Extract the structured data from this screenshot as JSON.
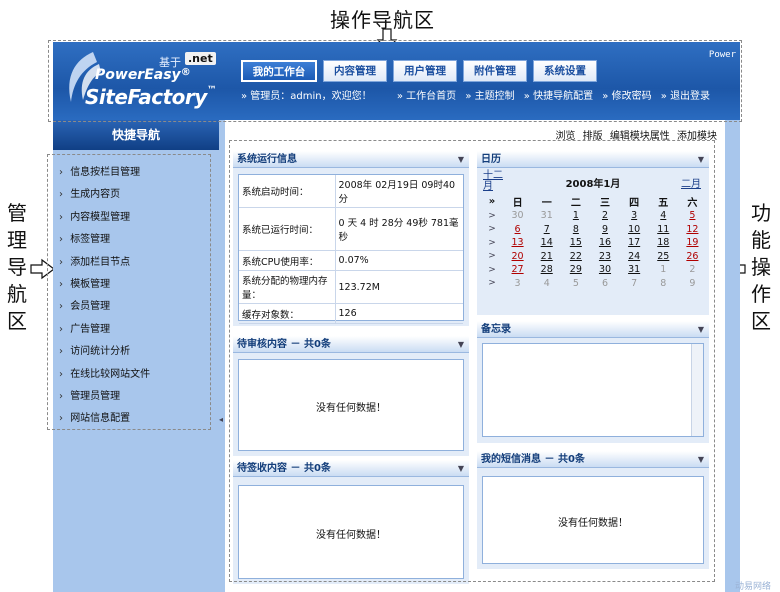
{
  "annotations": {
    "top": "操作导航区",
    "left": [
      "管",
      "理",
      "导",
      "航",
      "区"
    ],
    "right": [
      "功",
      "能",
      "操",
      "作",
      "区"
    ]
  },
  "header": {
    "based_on": "基于",
    "net_badge": ".net",
    "brand_top": "PowerEasy",
    "brand_bottom": "SiteFactory",
    "corner_text": "Power",
    "nav": [
      {
        "label": "我的工作台",
        "active": true
      },
      {
        "label": "内容管理",
        "active": false
      },
      {
        "label": "用户管理",
        "active": false
      },
      {
        "label": "附件管理",
        "active": false
      },
      {
        "label": "系统设置",
        "active": false
      }
    ],
    "greeting": "» 管理员：admin，欢迎您！",
    "links": [
      "» 工作台首页",
      "» 主题控制",
      "» 快捷导航配置",
      "» 修改密码",
      "» 退出登录"
    ]
  },
  "sidebar": {
    "title": "快捷导航",
    "items": [
      "信息按栏目管理",
      "生成内容页",
      "内容模型管理",
      "标签管理",
      "添加栏目节点",
      "模板管理",
      "会员管理",
      "广告管理",
      "访问统计分析",
      "在线比较网站文件",
      "管理员管理",
      "网站信息配置"
    ]
  },
  "toolbar": [
    "浏览",
    "排版",
    "编辑模块属性",
    "添加模块"
  ],
  "system_info": {
    "title": "系统运行信息",
    "rows": [
      {
        "key": "系统启动时间：",
        "value": "2008年 02月19日 09时40分"
      },
      {
        "key": "系统已运行时间：",
        "value": "0 天 4 时 28分 49秒 781毫秒"
      },
      {
        "key": "系统CPU使用率：",
        "value": "0.07%"
      },
      {
        "key": "系统分配的物理内存量：",
        "value": "123.72M"
      },
      {
        "key": "缓存对象数：",
        "value": "126"
      }
    ]
  },
  "pending_review": {
    "title": "待审核内容 － 共0条",
    "empty": "没有任何数据！"
  },
  "pending_sign": {
    "title": "待签收内容 － 共0条",
    "empty": "没有任何数据！"
  },
  "calendar": {
    "title": "日历",
    "prev": "十二月",
    "month": "2008年1月",
    "next": "二月",
    "weekdays": [
      "»",
      "日",
      "一",
      "二",
      "三",
      "四",
      "五",
      "六"
    ],
    "week_arrow": ">",
    "weeks": [
      [
        {
          "d": "30",
          "t": "other"
        },
        {
          "d": "31",
          "t": "other"
        },
        {
          "d": "1",
          "t": ""
        },
        {
          "d": "2",
          "t": ""
        },
        {
          "d": "3",
          "t": ""
        },
        {
          "d": "4",
          "t": ""
        },
        {
          "d": "5",
          "t": "wkend"
        }
      ],
      [
        {
          "d": "6",
          "t": "wkend"
        },
        {
          "d": "7",
          "t": ""
        },
        {
          "d": "8",
          "t": ""
        },
        {
          "d": "9",
          "t": ""
        },
        {
          "d": "10",
          "t": ""
        },
        {
          "d": "11",
          "t": ""
        },
        {
          "d": "12",
          "t": "wkend"
        }
      ],
      [
        {
          "d": "13",
          "t": "wkend"
        },
        {
          "d": "14",
          "t": ""
        },
        {
          "d": "15",
          "t": ""
        },
        {
          "d": "16",
          "t": ""
        },
        {
          "d": "17",
          "t": ""
        },
        {
          "d": "18",
          "t": ""
        },
        {
          "d": "19",
          "t": "wkend"
        }
      ],
      [
        {
          "d": "20",
          "t": "wkend"
        },
        {
          "d": "21",
          "t": ""
        },
        {
          "d": "22",
          "t": ""
        },
        {
          "d": "23",
          "t": ""
        },
        {
          "d": "24",
          "t": ""
        },
        {
          "d": "25",
          "t": ""
        },
        {
          "d": "26",
          "t": "wkend"
        }
      ],
      [
        {
          "d": "27",
          "t": "wkend"
        },
        {
          "d": "28",
          "t": ""
        },
        {
          "d": "29",
          "t": ""
        },
        {
          "d": "30",
          "t": ""
        },
        {
          "d": "31",
          "t": ""
        },
        {
          "d": "1",
          "t": "other"
        },
        {
          "d": "2",
          "t": "other"
        }
      ],
      [
        {
          "d": "3",
          "t": "other"
        },
        {
          "d": "4",
          "t": "other"
        },
        {
          "d": "5",
          "t": "other"
        },
        {
          "d": "6",
          "t": "other"
        },
        {
          "d": "7",
          "t": "other"
        },
        {
          "d": "8",
          "t": "other"
        },
        {
          "d": "9",
          "t": "other"
        }
      ]
    ]
  },
  "memo": {
    "title": "备忘录"
  },
  "messages": {
    "title": "我的短信消息 － 共0条",
    "empty": "没有任何数据！"
  },
  "watermark": "动易网络",
  "colors": {
    "header_blue": "#1d57a8",
    "sidebar_blue": "#a8c6ec",
    "weekend_red": "#b00000"
  }
}
